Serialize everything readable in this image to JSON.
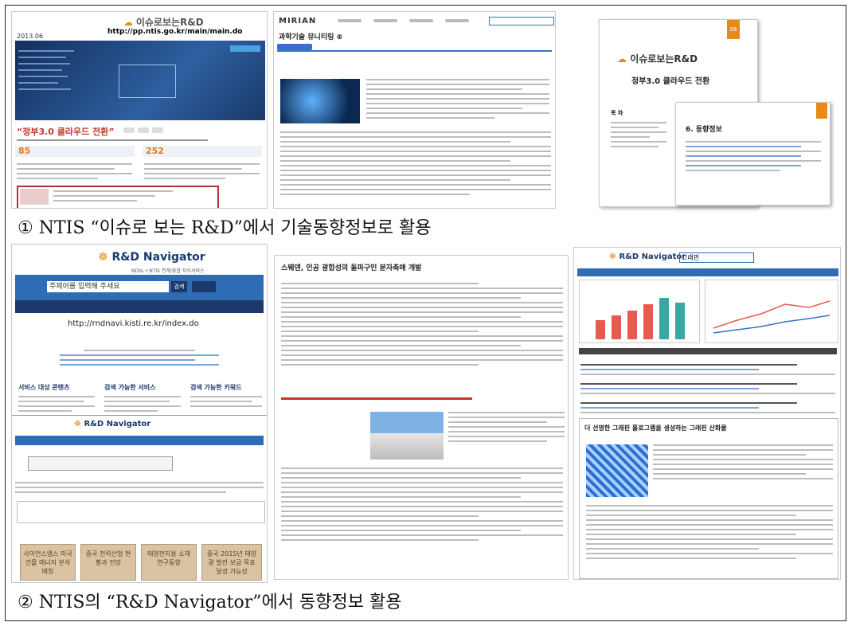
{
  "caption1": "① NTIS “이슈로 보는 R&D”에서 기술동향정보로 활용",
  "caption2": "② NTIS의 “R&D Navigator”에서 동향정보 활용",
  "shot1": {
    "brand": "이슈로보는R&D",
    "url": "http://pp.ntis.go.kr/main/main.do",
    "date": "2013.06",
    "headline": "“정부3.0 클라우드 전환”",
    "stat1": "85",
    "stat2": "252"
  },
  "shot2": {
    "logo": "MIRIAN",
    "page_title": "과학기술 뮤니티링 ⊕"
  },
  "shot3": {
    "brand": "이슈로보는R&D",
    "title": "정부3.0 클라우드 전환",
    "toc_title": "목 차",
    "trend_title": "6. 동향정보",
    "ribbon": "06"
  },
  "shot4": {
    "logo": "R&D Navigator",
    "subtitle": "NDSL＋NTIS 연계/융합 지식서비스",
    "search_placeholder": "주제어를 입력해 주세요",
    "search_btn": "검색",
    "url": "http://rndnavi.kisti.re.kr/index.do",
    "col1": "서비스 대상 콘텐츠",
    "col2": "검색 가능한 서비스",
    "col3": "검색 가능한 키워드",
    "logo2": "R&D Navigator",
    "card1": "사이언스앱스 미국 건물 에너지 분석 매칭",
    "card2": "중국 전력산업 현황과 전망",
    "card3": "태양전지용 소재 연구동향",
    "card4": "중국 2015년 태양광 발전 보급 목표 달성 가능성"
  },
  "shot5": {
    "title": "스웨덴, 인공 광합성의 돌파구인 분자촉매 개발"
  },
  "shot6": {
    "logo": "R&D Navigator",
    "search_value": "그래핀",
    "footer_title": "더 선명한 그래핀 홀로그램을 생성하는 그래핀 산화물"
  },
  "colors": {
    "navy": "#1b3a6b",
    "brand_orange": "#e88a1a",
    "card_tan": "#d9c3a3"
  }
}
